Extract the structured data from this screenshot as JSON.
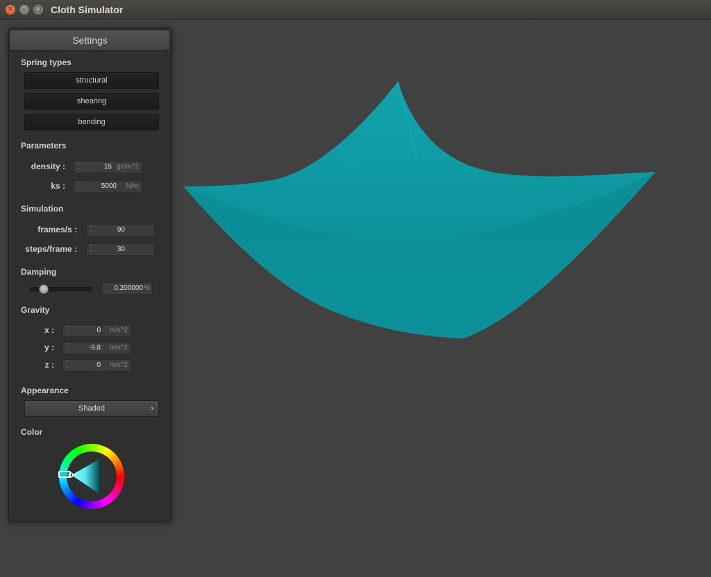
{
  "window": {
    "title": "Cloth Simulator"
  },
  "settings": {
    "title": "Settings",
    "spring_types": {
      "heading": "Spring types",
      "buttons": [
        "structural",
        "shearing",
        "bending"
      ]
    },
    "parameters": {
      "heading": "Parameters",
      "density": {
        "label": "density :",
        "value": "15",
        "unit": "g/cm^2"
      },
      "ks": {
        "label": "ks :",
        "value": "5000",
        "unit": "N/m"
      }
    },
    "simulation": {
      "heading": "Simulation",
      "fps": {
        "label": "frames/s :",
        "value": "90"
      },
      "steps": {
        "label": "steps/frame :",
        "value": "30"
      }
    },
    "damping": {
      "heading": "Damping",
      "slider_fraction": 0.2,
      "value": "0.200000",
      "unit": "%"
    },
    "gravity": {
      "heading": "Gravity",
      "x": {
        "label": "x :",
        "value": "0",
        "unit": "m/s^2"
      },
      "y": {
        "label": "y :",
        "value": "-9.8",
        "unit": "m/s^2"
      },
      "z": {
        "label": "z :",
        "value": "0",
        "unit": "m/s^2"
      }
    },
    "appearance": {
      "heading": "Appearance",
      "selected": "Shaded"
    },
    "color": {
      "heading": "Color",
      "selected_hex": "#0e9aa7"
    }
  },
  "icons": {
    "close": "close-icon",
    "minimize": "minimize-icon",
    "maximize": "maximize-icon",
    "chevron": "chevron-right-icon"
  }
}
